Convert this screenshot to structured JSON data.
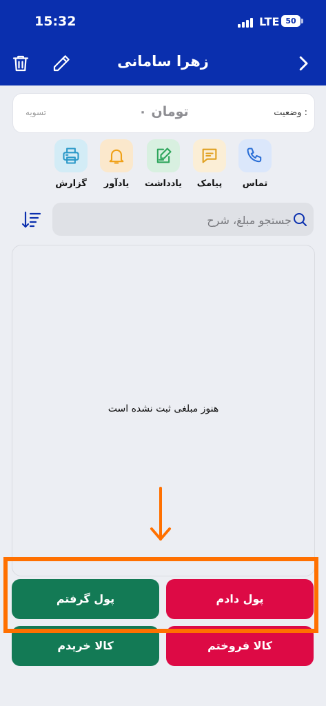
{
  "status_bar": {
    "time": "15:32",
    "network": "LTE",
    "battery": "50"
  },
  "header": {
    "title": "زهرا سامانی",
    "back_icon": "chevron-right-icon",
    "edit_icon": "pencil-icon",
    "delete_icon": "trash-icon",
    "background": "#0a2fae"
  },
  "status": {
    "label": "وضعیت :",
    "amount": "۰ تومان",
    "badge": "تسویه"
  },
  "actions": [
    {
      "label": "تماس",
      "icon": "phone-icon",
      "bg": "#dbe7fb",
      "color": "#2b6fd6"
    },
    {
      "label": "پیامک",
      "icon": "message-icon",
      "bg": "#fbeed6",
      "color": "#e0a020"
    },
    {
      "label": "یادداشت",
      "icon": "note-edit-icon",
      "bg": "#d8f0e0",
      "color": "#2ea55c"
    },
    {
      "label": "یادآور",
      "icon": "bell-icon",
      "bg": "#fbe8cc",
      "color": "#f0a016"
    },
    {
      "label": "گزارش",
      "icon": "printer-icon",
      "bg": "#d3ecf6",
      "color": "#2a98c8"
    }
  ],
  "search": {
    "placeholder": "جستجو مبلغ، شرح"
  },
  "list": {
    "empty_text": "هنوز مبلغی ثبت نشده است"
  },
  "buttons": {
    "gave_money": "پول دادم",
    "received_money": "پول گرفتم",
    "sold_goods": "کالا فروختم",
    "bought_goods": "کالا خریدم"
  },
  "colors": {
    "green": "#137a55",
    "red": "#dd0a45",
    "highlight": "#ff7000"
  }
}
